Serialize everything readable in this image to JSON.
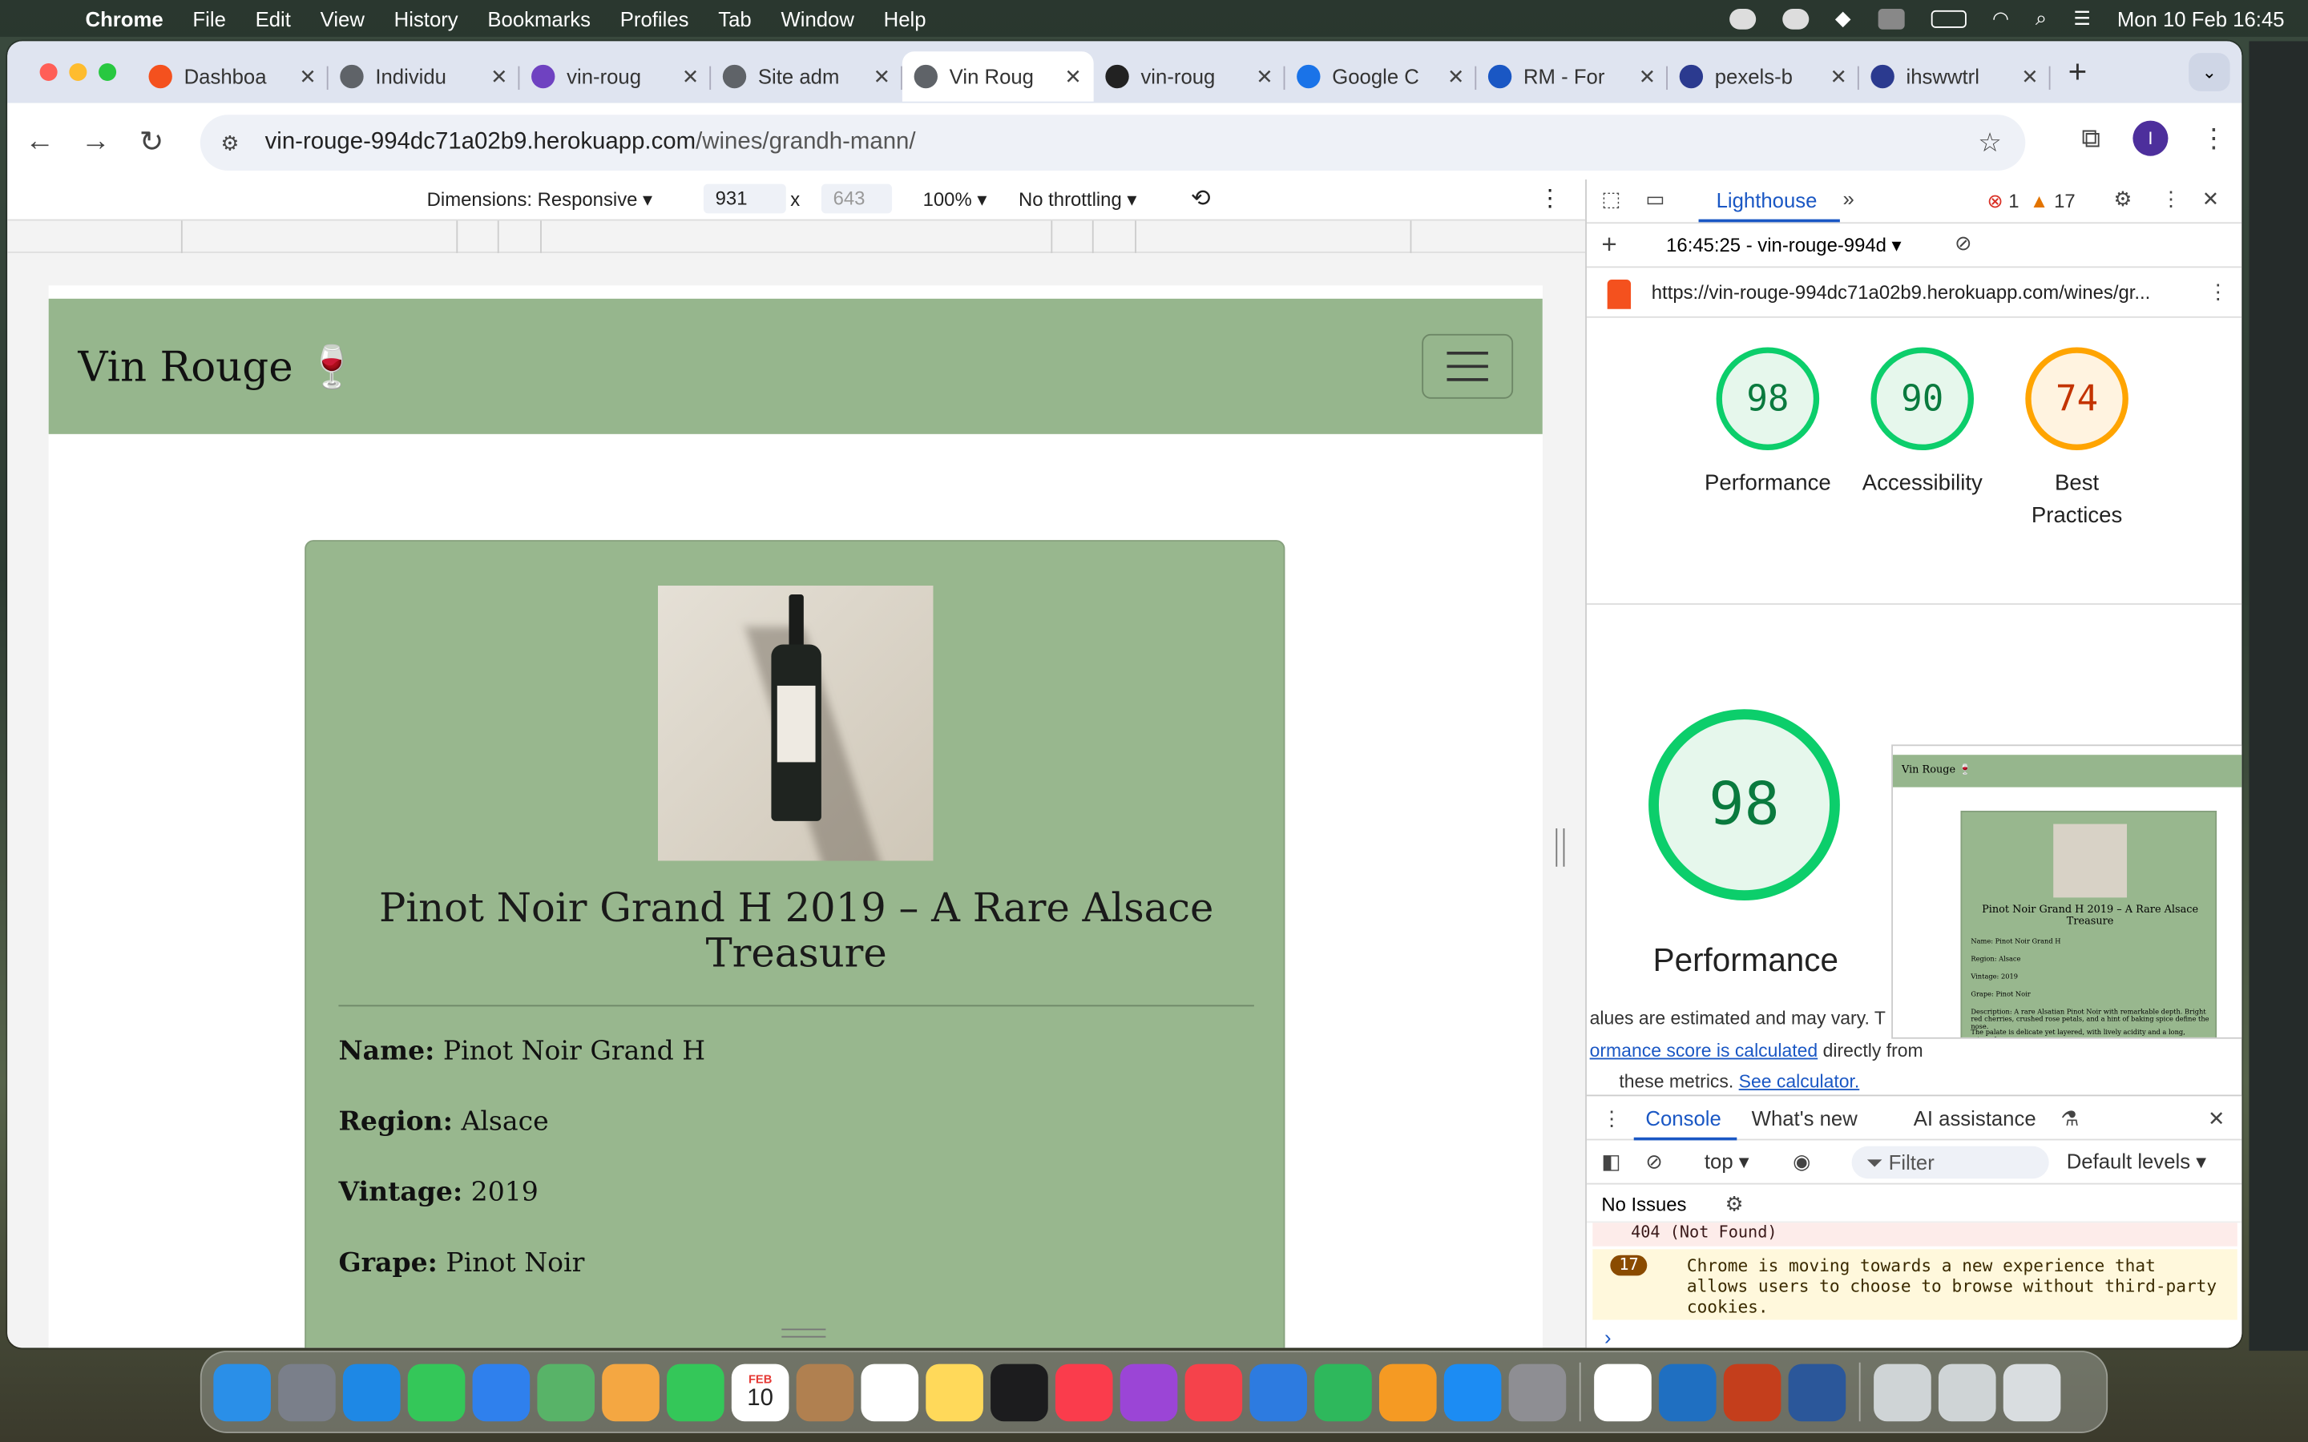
{
  "menubar": {
    "app": "Chrome",
    "items": [
      "File",
      "Edit",
      "View",
      "History",
      "Bookmarks",
      "Profiles",
      "Tab",
      "Window",
      "Help"
    ],
    "datetime": "Mon 10 Feb  16:45"
  },
  "tabs": [
    {
      "title": "Dashboa",
      "color": "#f4511e"
    },
    {
      "title": "Individu",
      "color": "#5f6368"
    },
    {
      "title": "vin-roug",
      "color": "#6f42c1"
    },
    {
      "title": "Site adm",
      "color": "#5f6368"
    },
    {
      "title": "Vin Roug",
      "color": "#5f6368",
      "active": true
    },
    {
      "title": "vin-roug",
      "color": "#222222"
    },
    {
      "title": "Google C",
      "color": "#1a73e8"
    },
    {
      "title": "RM - For",
      "color": "#1a57c4"
    },
    {
      "title": "pexels-b",
      "color": "#2b3a8f"
    },
    {
      "title": "ihswwtrl",
      "color": "#2b3a8f"
    }
  ],
  "omnibox": {
    "domain": "vin-rouge-994dc71a02b9.herokuapp.com",
    "path": "/wines/grandh-mann/"
  },
  "profile_initial": "I",
  "device_toolbar": {
    "dimensions": "Dimensions: Responsive ▾",
    "width": "931",
    "x": "x",
    "height": "643",
    "zoom": "100% ▾",
    "throttling": "No throttling ▾"
  },
  "site": {
    "brand": "Vin Rouge 🍷",
    "wine_title": "Pinot Noir Grand H 2019 – A Rare Alsace Treasure",
    "fields": [
      {
        "label": "Name:",
        "value": " Pinot Noir Grand H"
      },
      {
        "label": "Region:",
        "value": " Alsace"
      },
      {
        "label": "Vintage:",
        "value": " 2019"
      },
      {
        "label": "Grape:",
        "value": " Pinot Noir"
      }
    ]
  },
  "devtools": {
    "panel": "Lighthouse",
    "errors": "1",
    "warnings": "17",
    "report_label": "16:45:25 - vin-rouge-994d ▾",
    "report_url": "https://vin-rouge-994dc71a02b9.herokuapp.com/wines/gr...",
    "scores": [
      {
        "value": "98",
        "label": "Performance",
        "status": "pass"
      },
      {
        "value": "90",
        "label": "Accessibility",
        "status": "pass"
      },
      {
        "value": "74",
        "label": "Best Practices",
        "status": "average"
      }
    ],
    "big_score": "98",
    "big_label": "Performance",
    "note1": "alues are estimated and may vary. T",
    "note2_link": "ormance score is calculated",
    "note2_text": " directly from",
    "note3_text": "these metrics. ",
    "note3_link": "See calculator.",
    "thumb": {
      "brand": "Vin Rouge 🍷",
      "title": "Pinot Noir Grand H 2019 – A Rare Alsace Treasure",
      "fields": [
        "Name: Pinot Noir Grand H",
        "Region: Alsace",
        "Vintage: 2019",
        "Grape: Pinot Noir",
        "Description: A rare Alsatian Pinot Noir with remarkable depth. Bright red cherries, crushed rose petals, and a hint of baking spice define the nose.",
        "The palate is delicate yet layered, with lively acidity and a long, mineral-"
      ]
    }
  },
  "drawer": {
    "tabs": [
      "Console",
      "What's new",
      "AI assistance"
    ],
    "context": "top ▾",
    "filter_placeholder": "Filter",
    "levels": "Default levels ▾",
    "issues": "No Issues",
    "error_msg": "404 (Not Found)",
    "warn_count": "17",
    "warn_msg": "Chrome is moving towards a new experience that allows users to choose to browse without third-party cookies."
  },
  "dock": {
    "calendar_month": "FEB",
    "calendar_day": "10",
    "apps": [
      "finder",
      "launchpad",
      "safari",
      "messages",
      "mail",
      "maps",
      "photos",
      "facetime",
      "calendar",
      "contacts",
      "reminders",
      "notes",
      "apple-tv",
      "music",
      "podcasts",
      "news",
      "keynote",
      "numbers",
      "pages",
      "app-store",
      "system-settings",
      "chrome",
      "vscode",
      "powerpoint",
      "word",
      "downloads",
      "recent",
      "trash"
    ],
    "colors": {
      "accent": "#96b68d",
      "lighthouse_pass": "#0cce6b",
      "lighthouse_avg": "#ffa400"
    }
  }
}
